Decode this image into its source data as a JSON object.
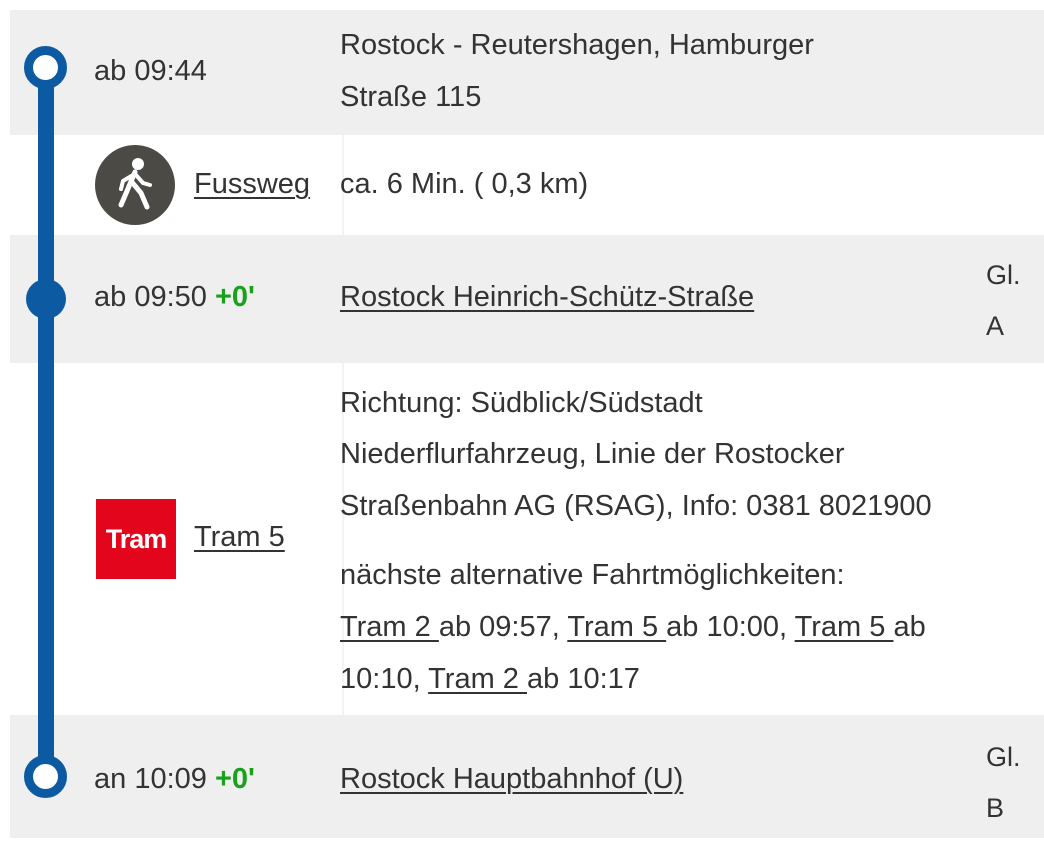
{
  "departure": {
    "time": "ab 09:44",
    "address_line1": "Rostock - Reutershagen, Hamburger",
    "address_line2": "Straße 115"
  },
  "walk": {
    "icon": "pedestrian-icon",
    "label": "Fussweg",
    "duration": "ca. 6 Min. ( 0,3 km)"
  },
  "stop": {
    "time": "ab 09:50",
    "delay": "+0'",
    "name": "Rostock Heinrich-Schütz-Straße",
    "platform_label": "Gl.",
    "platform": "A"
  },
  "tram": {
    "badge": "Tram",
    "label": "Tram 5",
    "direction": "Richtung: Südblick/Südstadt",
    "info_line1": "Niederflurfahrzeug, Linie der Rostocker",
    "info_line2": "Straßenbahn AG (RSAG), Info: 0381 8021900",
    "alt_heading": "nächste alternative Fahrtmöglichkeiten:",
    "alternatives": [
      {
        "line": "Tram 2 ",
        "time": "ab 09:57",
        "sep": ", "
      },
      {
        "line": "Tram 5 ",
        "time": "ab 10:00",
        "sep": ", "
      },
      {
        "line": "Tram 5 ",
        "time": "ab",
        "sep": ""
      },
      {
        "line": "",
        "time": "10:10",
        "sep": ", "
      },
      {
        "line": "Tram 2 ",
        "time": "ab 10:17",
        "sep": ""
      }
    ],
    "colors": {
      "badge_bg": "#e3051b",
      "route_line": "#0b5aa2",
      "delay": "#18a11a"
    }
  },
  "arrival": {
    "time": "an 10:09",
    "delay": "+0'",
    "name": "Rostock Hauptbahnhof (U)",
    "platform_label": "Gl.",
    "platform": "B"
  }
}
